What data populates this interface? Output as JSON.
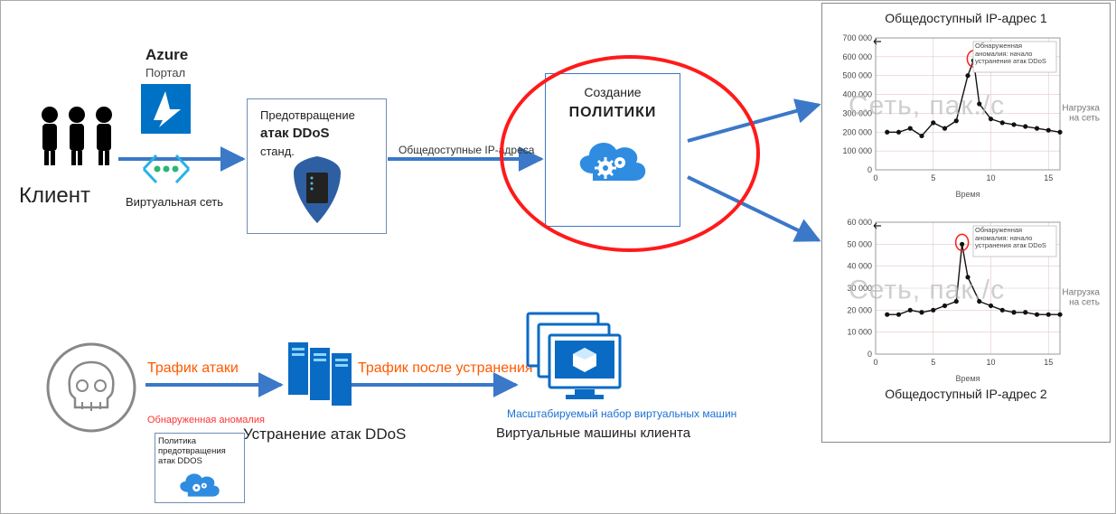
{
  "top": {
    "client_label": "Клиент",
    "azure_label": "Azure",
    "portal_label": "Портал",
    "vnet_label": "Виртуальная сеть",
    "ddos_box_l1": "Предотвращение",
    "ddos_box_l2": "атак DDoS",
    "ddos_box_l3": "станд.",
    "public_ips_label": "Общедоступные IP-адреса",
    "policy_t1": "Создание",
    "policy_t2": "ПОЛИТИКИ"
  },
  "bottom": {
    "attack_traffic": "Трафик атаки",
    "post_traffic": "Трафик после устранения атаки",
    "anomaly_detected": "Обнаруженная аномалия",
    "policy_caption": "Политика предотвращения атак DDOS",
    "mitigation_title": "Устранение атак DDoS",
    "vmss_caption": "Масштабируемый набор виртуальных машин",
    "client_vms": "Виртуальные машины клиента"
  },
  "charts": {
    "title1": "Общедоступный IP-адрес 1",
    "title2": "Общедоступный IP-адрес 2",
    "watermark": "Сеть, пак./с",
    "xlabel": "Время",
    "legend": "Обнаруженная аномалия: начало устранения атак DDoS",
    "net_load": "Нагрузка на сеть"
  },
  "chart_data": [
    {
      "type": "line",
      "title": "Общедоступный IP-адрес 1",
      "xlabel": "Время",
      "ylabel": "Сеть, пак./с",
      "xlim": [
        0,
        16
      ],
      "ylim": [
        0,
        700000
      ],
      "x": [
        1,
        2,
        3,
        4,
        5,
        6,
        7,
        8,
        8.5,
        9,
        10,
        11,
        12,
        13,
        14,
        15,
        16
      ],
      "values": [
        200000,
        200000,
        220000,
        180000,
        250000,
        220000,
        260000,
        500000,
        580000,
        350000,
        270000,
        250000,
        240000,
        230000,
        220000,
        210000,
        200000
      ],
      "anomaly_x": 8.5,
      "yticks": [
        0,
        100000,
        200000,
        300000,
        400000,
        500000,
        600000,
        700000
      ],
      "xticks": [
        0,
        5,
        10,
        15
      ]
    },
    {
      "type": "line",
      "title": "Общедоступный IP-адрес 2",
      "xlabel": "Время",
      "ylabel": "Сеть, пак./с",
      "xlim": [
        0,
        16
      ],
      "ylim": [
        0,
        60000
      ],
      "x": [
        1,
        2,
        3,
        4,
        5,
        6,
        7,
        7.5,
        8,
        9,
        10,
        11,
        12,
        13,
        14,
        15,
        16
      ],
      "values": [
        18000,
        18000,
        20000,
        19000,
        20000,
        22000,
        24000,
        50000,
        35000,
        24000,
        22000,
        20000,
        19000,
        19000,
        18000,
        18000,
        18000
      ],
      "anomaly_x": 7.5,
      "yticks": [
        0,
        10000,
        20000,
        30000,
        40000,
        50000,
        60000
      ],
      "xticks": [
        0,
        5,
        10,
        15
      ]
    }
  ]
}
